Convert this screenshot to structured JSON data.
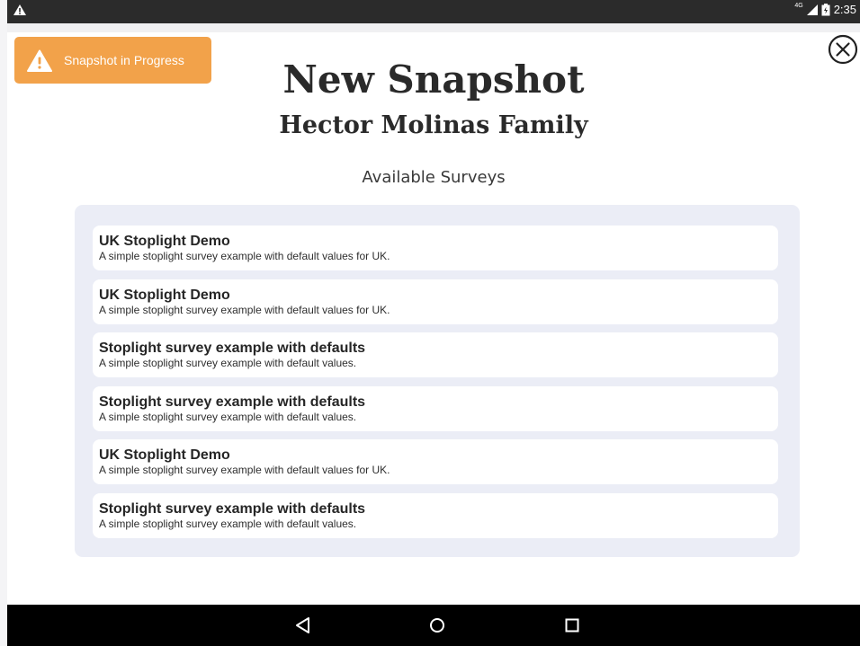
{
  "status_bar": {
    "warning_icon": "warning-triangle-icon",
    "network": "4G",
    "time": "2:35"
  },
  "banner": {
    "text": "Snapshot in Progress",
    "icon": "warning-icon",
    "color": "#f2a24a"
  },
  "header": {
    "title": "New Snapshot",
    "family": "Hector Molinas Family",
    "close_icon": "close-circle-icon"
  },
  "surveys": {
    "heading": "Available Surveys",
    "items": [
      {
        "title": "UK Stoplight Demo",
        "description": "A simple stoplight survey example with default values for UK."
      },
      {
        "title": "UK Stoplight Demo",
        "description": "A simple stoplight survey example with default values for UK."
      },
      {
        "title": "Stoplight survey example with defaults",
        "description": "A simple stoplight survey example with default values."
      },
      {
        "title": "Stoplight survey example with defaults",
        "description": "A simple stoplight survey example with default values."
      },
      {
        "title": "UK Stoplight Demo",
        "description": "A simple stoplight survey example with default values for UK."
      },
      {
        "title": "Stoplight survey example with defaults",
        "description": "A simple stoplight survey example with default values."
      }
    ]
  },
  "nav_bar": {
    "back_icon": "back-triangle-icon",
    "home_icon": "home-circle-icon",
    "recents_icon": "recents-square-icon"
  }
}
